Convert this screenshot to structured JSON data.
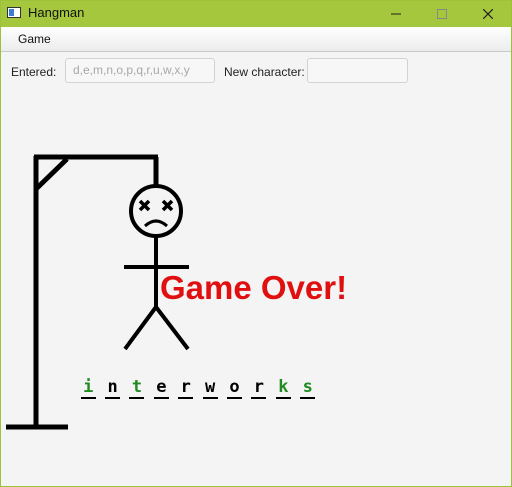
{
  "window": {
    "title": "Hangman"
  },
  "menu": {
    "game": "Game"
  },
  "controls": {
    "entered_label": "Entered:",
    "entered_value": "d,e,m,n,o,p,q,r,u,w,x,y",
    "new_char_label": "New character:",
    "new_char_value": ""
  },
  "status": {
    "message": "Game Over!"
  },
  "word": [
    {
      "ch": "i",
      "guessed": false
    },
    {
      "ch": "n",
      "guessed": true
    },
    {
      "ch": "t",
      "guessed": false
    },
    {
      "ch": "e",
      "guessed": true
    },
    {
      "ch": "r",
      "guessed": true
    },
    {
      "ch": "w",
      "guessed": true
    },
    {
      "ch": "o",
      "guessed": true
    },
    {
      "ch": "r",
      "guessed": true
    },
    {
      "ch": "k",
      "guessed": false
    },
    {
      "ch": "s",
      "guessed": false
    }
  ],
  "colors": {
    "guessed": "#000000",
    "revealed": "#228b22",
    "game_over": "#e01010",
    "titlebar": "#a5c73e"
  },
  "icons": {
    "minimize": "minimize-icon",
    "maximize": "maximize-icon",
    "close": "close-icon"
  }
}
